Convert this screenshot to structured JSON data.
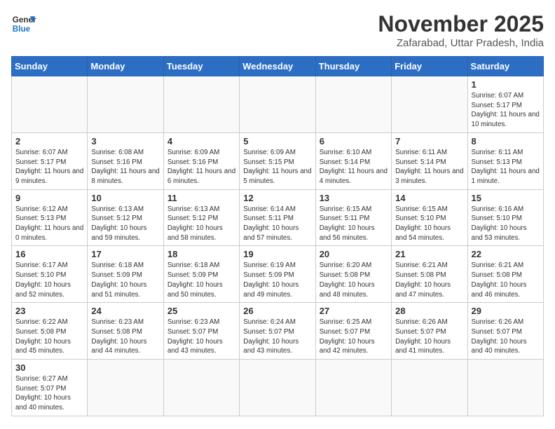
{
  "logo": {
    "line1": "General",
    "line2": "Blue"
  },
  "title": "November 2025",
  "subtitle": "Zafarabad, Uttar Pradesh, India",
  "days_of_week": [
    "Sunday",
    "Monday",
    "Tuesday",
    "Wednesday",
    "Thursday",
    "Friday",
    "Saturday"
  ],
  "weeks": [
    [
      {
        "day": null
      },
      {
        "day": null
      },
      {
        "day": null
      },
      {
        "day": null
      },
      {
        "day": null
      },
      {
        "day": null
      },
      {
        "day": 1,
        "sunrise": "6:07 AM",
        "sunset": "5:17 PM",
        "daylight": "11 hours and 10 minutes."
      }
    ],
    [
      {
        "day": 2,
        "sunrise": "6:07 AM",
        "sunset": "5:17 PM",
        "daylight": "11 hours and 9 minutes."
      },
      {
        "day": 3,
        "sunrise": "6:08 AM",
        "sunset": "5:16 PM",
        "daylight": "11 hours and 8 minutes."
      },
      {
        "day": 4,
        "sunrise": "6:09 AM",
        "sunset": "5:16 PM",
        "daylight": "11 hours and 6 minutes."
      },
      {
        "day": 5,
        "sunrise": "6:09 AM",
        "sunset": "5:15 PM",
        "daylight": "11 hours and 5 minutes."
      },
      {
        "day": 6,
        "sunrise": "6:10 AM",
        "sunset": "5:14 PM",
        "daylight": "11 hours and 4 minutes."
      },
      {
        "day": 7,
        "sunrise": "6:11 AM",
        "sunset": "5:14 PM",
        "daylight": "11 hours and 3 minutes."
      },
      {
        "day": 8,
        "sunrise": "6:11 AM",
        "sunset": "5:13 PM",
        "daylight": "11 hours and 1 minute."
      }
    ],
    [
      {
        "day": 9,
        "sunrise": "6:12 AM",
        "sunset": "5:13 PM",
        "daylight": "11 hours and 0 minutes."
      },
      {
        "day": 10,
        "sunrise": "6:13 AM",
        "sunset": "5:12 PM",
        "daylight": "10 hours and 59 minutes."
      },
      {
        "day": 11,
        "sunrise": "6:13 AM",
        "sunset": "5:12 PM",
        "daylight": "10 hours and 58 minutes."
      },
      {
        "day": 12,
        "sunrise": "6:14 AM",
        "sunset": "5:11 PM",
        "daylight": "10 hours and 57 minutes."
      },
      {
        "day": 13,
        "sunrise": "6:15 AM",
        "sunset": "5:11 PM",
        "daylight": "10 hours and 56 minutes."
      },
      {
        "day": 14,
        "sunrise": "6:15 AM",
        "sunset": "5:10 PM",
        "daylight": "10 hours and 54 minutes."
      },
      {
        "day": 15,
        "sunrise": "6:16 AM",
        "sunset": "5:10 PM",
        "daylight": "10 hours and 53 minutes."
      }
    ],
    [
      {
        "day": 16,
        "sunrise": "6:17 AM",
        "sunset": "5:10 PM",
        "daylight": "10 hours and 52 minutes."
      },
      {
        "day": 17,
        "sunrise": "6:18 AM",
        "sunset": "5:09 PM",
        "daylight": "10 hours and 51 minutes."
      },
      {
        "day": 18,
        "sunrise": "6:18 AM",
        "sunset": "5:09 PM",
        "daylight": "10 hours and 50 minutes."
      },
      {
        "day": 19,
        "sunrise": "6:19 AM",
        "sunset": "5:09 PM",
        "daylight": "10 hours and 49 minutes."
      },
      {
        "day": 20,
        "sunrise": "6:20 AM",
        "sunset": "5:08 PM",
        "daylight": "10 hours and 48 minutes."
      },
      {
        "day": 21,
        "sunrise": "6:21 AM",
        "sunset": "5:08 PM",
        "daylight": "10 hours and 47 minutes."
      },
      {
        "day": 22,
        "sunrise": "6:21 AM",
        "sunset": "5:08 PM",
        "daylight": "10 hours and 46 minutes."
      }
    ],
    [
      {
        "day": 23,
        "sunrise": "6:22 AM",
        "sunset": "5:08 PM",
        "daylight": "10 hours and 45 minutes."
      },
      {
        "day": 24,
        "sunrise": "6:23 AM",
        "sunset": "5:08 PM",
        "daylight": "10 hours and 44 minutes."
      },
      {
        "day": 25,
        "sunrise": "6:23 AM",
        "sunset": "5:07 PM",
        "daylight": "10 hours and 43 minutes."
      },
      {
        "day": 26,
        "sunrise": "6:24 AM",
        "sunset": "5:07 PM",
        "daylight": "10 hours and 43 minutes."
      },
      {
        "day": 27,
        "sunrise": "6:25 AM",
        "sunset": "5:07 PM",
        "daylight": "10 hours and 42 minutes."
      },
      {
        "day": 28,
        "sunrise": "6:26 AM",
        "sunset": "5:07 PM",
        "daylight": "10 hours and 41 minutes."
      },
      {
        "day": 29,
        "sunrise": "6:26 AM",
        "sunset": "5:07 PM",
        "daylight": "10 hours and 40 minutes."
      }
    ],
    [
      {
        "day": 30,
        "sunrise": "6:27 AM",
        "sunset": "5:07 PM",
        "daylight": "10 hours and 40 minutes."
      },
      {
        "day": null
      },
      {
        "day": null
      },
      {
        "day": null
      },
      {
        "day": null
      },
      {
        "day": null
      },
      {
        "day": null
      }
    ]
  ]
}
